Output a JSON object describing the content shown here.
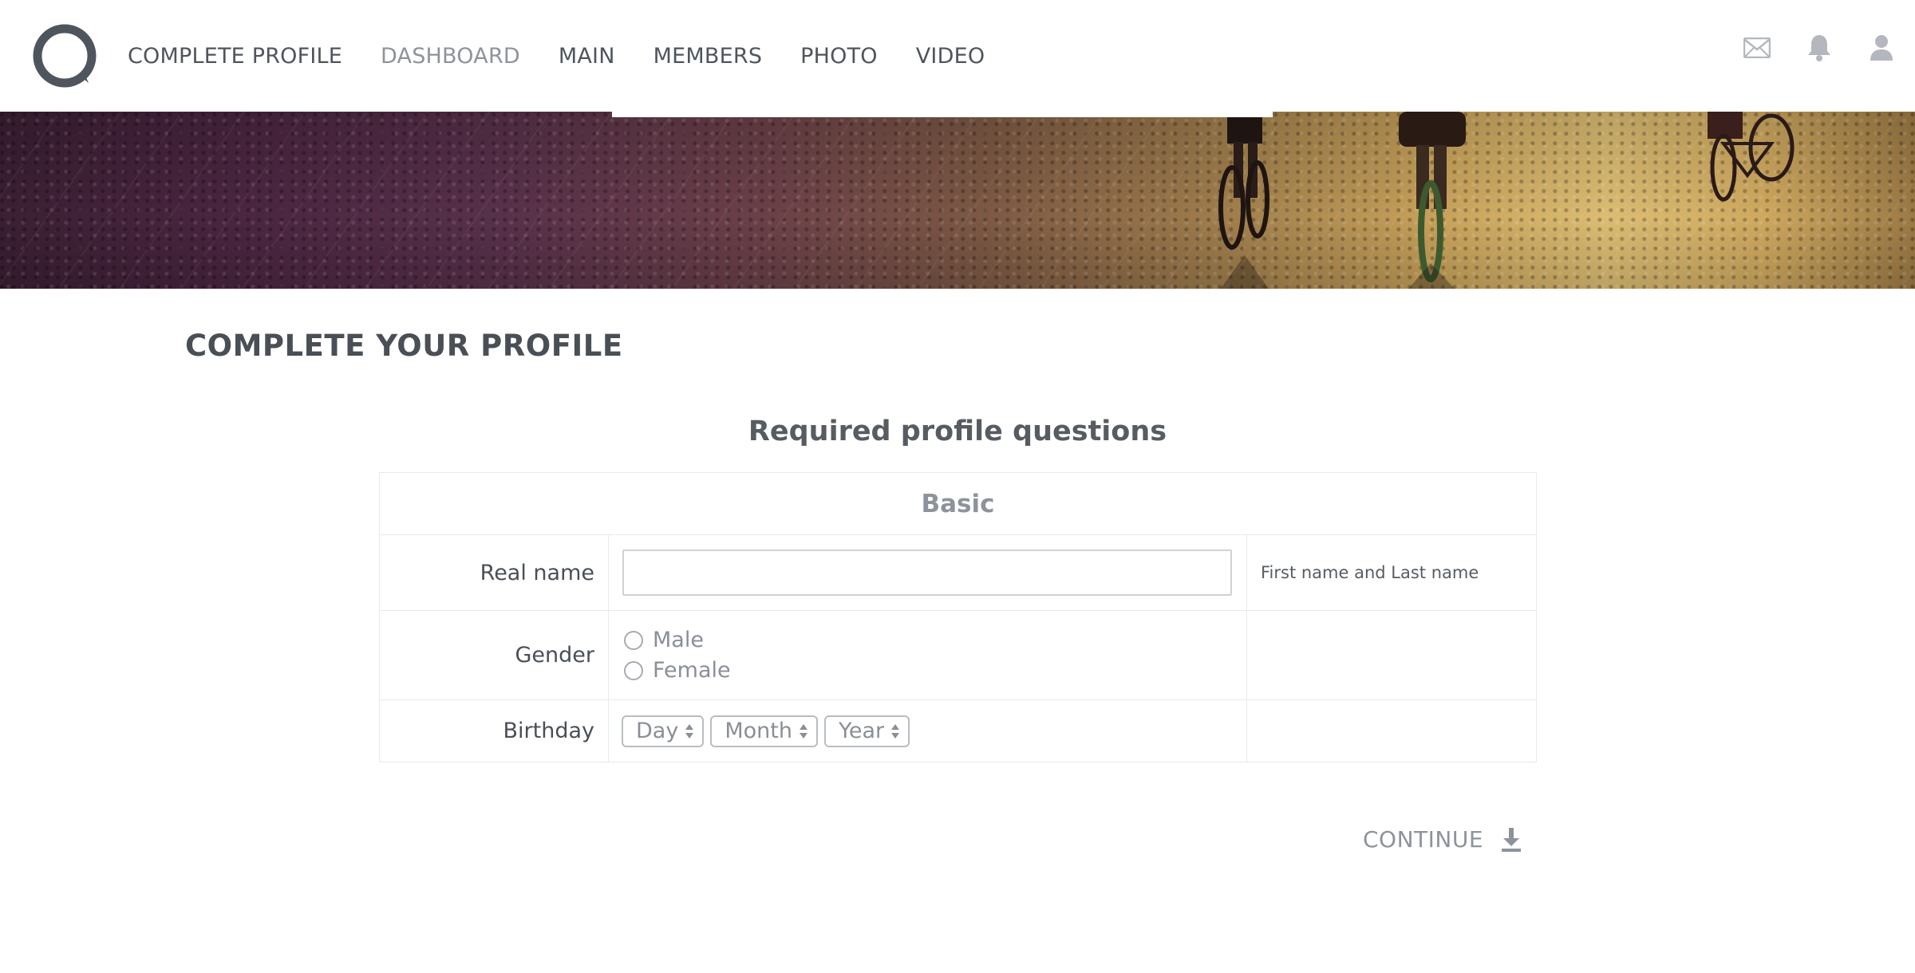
{
  "header": {
    "nav": [
      {
        "label": "COMPLETE PROFILE"
      },
      {
        "label": "DASHBOARD"
      },
      {
        "label": "MAIN"
      },
      {
        "label": "MEMBERS"
      },
      {
        "label": "PHOTO"
      },
      {
        "label": "VIDEO"
      }
    ],
    "icons": [
      "mail-icon",
      "bell-icon",
      "user-icon"
    ]
  },
  "main": {
    "page_title": "COMPLETE YOUR PROFILE",
    "section_title": "Required profile questions",
    "group": "Basic",
    "fields": {
      "real_name": {
        "label": "Real name",
        "value": "",
        "description": "First name and Last name"
      },
      "gender": {
        "label": "Gender",
        "options": [
          "Male",
          "Female"
        ]
      },
      "birthday": {
        "label": "Birthday",
        "day": "Day",
        "month": "Month",
        "year": "Year"
      }
    },
    "continue_label": "CONTINUE"
  },
  "colors": {
    "text": "#575c63",
    "muted": "#8e939b",
    "border": "#e8e9eb"
  }
}
